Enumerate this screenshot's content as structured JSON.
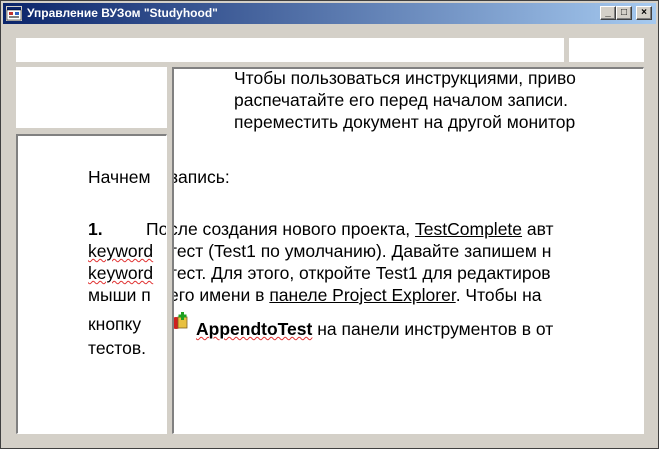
{
  "window": {
    "title": "Управление ВУЗом \"Studyhood\"",
    "buttons": {
      "minimize": "_",
      "maximize": "□",
      "close": "×"
    }
  },
  "document": {
    "right_top_lines": [
      "Чтобы пользоваться инструкциями, приво",
      "распечатайте его перед началом записи.",
      "переместить документ на другой монитор"
    ],
    "left_lines": {
      "heading": "Начнем",
      "step_no": "1.",
      "l2": "keyword",
      "l3": "keyword",
      "l4": "мыши п",
      "l5": "кнопку",
      "l6": "тестов."
    },
    "right_lines": {
      "heading": "запись:",
      "l1a": "сле создания нового проекта, ",
      "l1b": "TestComplete",
      "l1c": " авт",
      "l2": " тест (Test1 по умолчанию). Давайте запишем н",
      "l3": " тест. Для этого, откройте Test1 для редактиров",
      "l4a": " его имени в ",
      "l4b": "панеле Project Explorer",
      "l4c": ". Чтобы на",
      "l5a": "AppendtoTest",
      "l5b": " на панели инструментов в от"
    }
  }
}
